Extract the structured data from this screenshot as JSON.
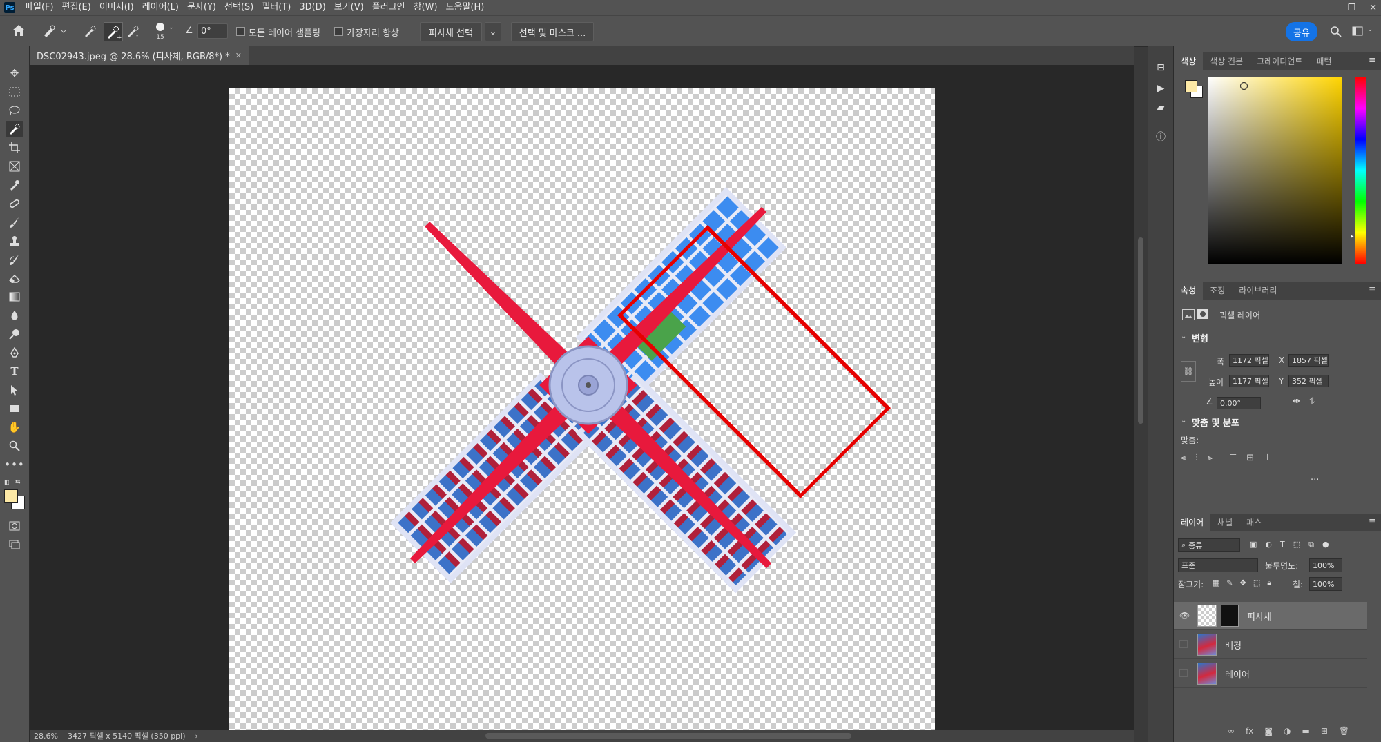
{
  "menubar": {
    "logo": "Ps",
    "items": [
      "파일(F)",
      "편집(E)",
      "이미지(I)",
      "레이어(L)",
      "문자(Y)",
      "선택(S)",
      "필터(T)",
      "3D(D)",
      "보기(V)",
      "플러그인",
      "창(W)",
      "도움말(H)"
    ],
    "window_controls": [
      "—",
      "❐",
      "✕"
    ]
  },
  "options": {
    "brush_size": "15",
    "angle": "0°",
    "sample_all_layers": "모든 레이어 샘플링",
    "enhance_edge": "가장자리 향상",
    "select_subject": "피사체 선택",
    "select_and_mask": "선택 및 마스크 ...",
    "share": "공유"
  },
  "document": {
    "tab_title": "DSC02943.jpeg @ 28.6% (피사체, RGB/8*) *",
    "zoom": "28.6%",
    "info": "3427 픽셀 x 5140 픽셀 (350 ppi)"
  },
  "color_panel": {
    "tabs": [
      "색상",
      "색상 견본",
      "그레이디언트",
      "패턴"
    ],
    "foreground": "#fde9a6",
    "background": "#ffffff"
  },
  "properties": {
    "tabs": [
      "속성",
      "조정",
      "라이브러리"
    ],
    "layer_type": "픽셀 레이어",
    "transform_header": "변형",
    "width_label": "폭",
    "width": "1172 픽셀",
    "x_label": "X",
    "x": "1857 픽셀",
    "height_label": "높이",
    "height": "1177 픽셀",
    "y_label": "Y",
    "y": "352 픽셀",
    "angle": "0.00°",
    "align_header": "맞춤 및 분포",
    "align_label": "맞춤:",
    "more": "..."
  },
  "layers_panel": {
    "tabs": [
      "레이어",
      "채널",
      "패스"
    ],
    "filter": "종류",
    "blend_mode": "표준",
    "opacity_label": "불투명도:",
    "opacity": "100%",
    "lock_label": "잠그기:",
    "fill_label": "칠:",
    "fill": "100%",
    "layers": [
      {
        "name": "피사체",
        "visible": true,
        "selected": true
      },
      {
        "name": "배경",
        "visible": false,
        "selected": false
      },
      {
        "name": "레이어",
        "visible": false,
        "selected": false
      }
    ]
  },
  "colors": {
    "accent": "#1473e6",
    "selection_box": "#e60000",
    "blade": "#e8193c"
  }
}
